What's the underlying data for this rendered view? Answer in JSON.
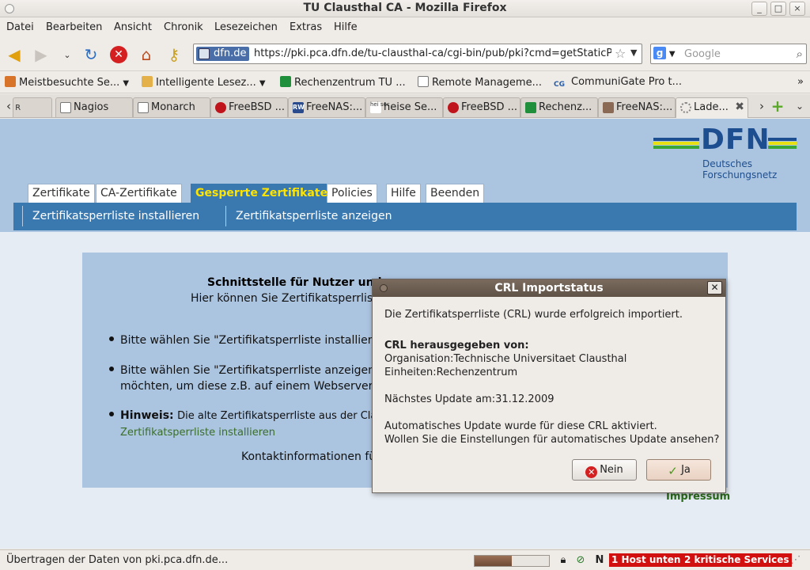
{
  "window": {
    "title": "TU Clausthal CA - Mozilla Firefox",
    "controls": [
      "_",
      "□",
      "×"
    ]
  },
  "menu": [
    "Datei",
    "Bearbeiten",
    "Ansicht",
    "Chronik",
    "Lesezeichen",
    "Extras",
    "Hilfe"
  ],
  "navbar": {
    "site_identity": "dfn.de",
    "url": "https://pki.pca.dfn.de/tu-clausthal-ca/cgi-bin/pub/pki?cmd=getStaticPag",
    "search_placeholder": "Google"
  },
  "bookmarks": [
    {
      "label": "Meistbesuchte Se...",
      "icon": "bookmark-icon",
      "dropdown": true
    },
    {
      "label": "Intelligente Lesez...",
      "icon": "folder-icon",
      "dropdown": true
    },
    {
      "label": "Rechenzentrum TU ...",
      "icon": "green-square-icon",
      "dropdown": false
    },
    {
      "label": "Remote Manageme...",
      "icon": "page-icon",
      "dropdown": false
    },
    {
      "label": "CommuniGate Pro t...",
      "icon": "cg-icon",
      "dropdown": false
    }
  ],
  "tabs": [
    {
      "label": "",
      "icon": ""
    },
    {
      "label": "Nagios",
      "icon": "page-icon"
    },
    {
      "label": "Monarch",
      "icon": "page-icon"
    },
    {
      "label": "FreeBSD ...",
      "icon": "freebsd-icon"
    },
    {
      "label": "FreeNAS:...",
      "icon": "freenas-icon"
    },
    {
      "label": "heise Se...",
      "icon": "heise-icon"
    },
    {
      "label": "FreeBSD ...",
      "icon": "freebsd-icon"
    },
    {
      "label": "Rechenz...",
      "icon": "green-square-icon"
    },
    {
      "label": "FreeNAS:...",
      "icon": "freenas-icon"
    },
    {
      "label": "Lade...",
      "icon": "loading-icon"
    }
  ],
  "logo": {
    "name": "DFN",
    "subtitle_line1": "Deutsches",
    "subtitle_line2": "Forschungsnetz",
    "colors": [
      "#1d4e8f",
      "#e8e010",
      "#3aa635"
    ]
  },
  "page_tabs": [
    {
      "label": "Zertifikate",
      "selected": false
    },
    {
      "label": "CA-Zertifikate",
      "selected": false
    },
    {
      "label": "Gesperrte Zertifikate",
      "selected": true
    },
    {
      "label": "Policies",
      "selected": false
    },
    {
      "label": "Hilfe",
      "selected": false
    },
    {
      "label": "Beenden",
      "selected": false
    }
  ],
  "sub_nav": [
    "Zertifikatsperrliste installieren",
    "Zertifikatsperrliste anzeigen"
  ],
  "content": {
    "heading": "Schnittstelle für Nutzer und",
    "intro": "Hier können Sie Zertifikatsperrliste",
    "bullet1": "Bitte wählen Sie \"Zertifikatsperrliste installiere",
    "bullet2_line1": "Bitte wählen Sie \"Zertifikatsperrliste anzeigen\"",
    "bullet2_line2": "möchten, um diese z.B. auf einem Webserver",
    "hint_label": "Hinweis:",
    "hint_text": "Die alte Zertifikatsperrliste aus der Class",
    "hint_link": "Zertifikatsperrliste installieren",
    "contact": "Kontaktinformationen für",
    "impressum": "Impressum"
  },
  "dialog": {
    "title": "CRL Importstatus",
    "message": "Die Zertifikatsperrliste (CRL) wurde erfolgreich importiert.",
    "issuer_heading": "CRL herausgegeben von:",
    "organisation": "Organisation:Technische Universitaet Clausthal",
    "units": "Einheiten:Rechenzentrum",
    "next_update": "Nächstes Update am:31.12.2009",
    "auto_line1": "Automatisches Update wurde für diese CRL aktiviert.",
    "auto_line2": "Wollen Sie die Einstellungen für automatisches Update ansehen?",
    "no_label": "Nein",
    "yes_label": "Ja"
  },
  "status": {
    "message": "Übertragen der Daten von pki.pca.dfn.de...",
    "progress": 0.5,
    "hosts_badge": "1 Host unten",
    "services_badge": "2 kritische Services"
  }
}
